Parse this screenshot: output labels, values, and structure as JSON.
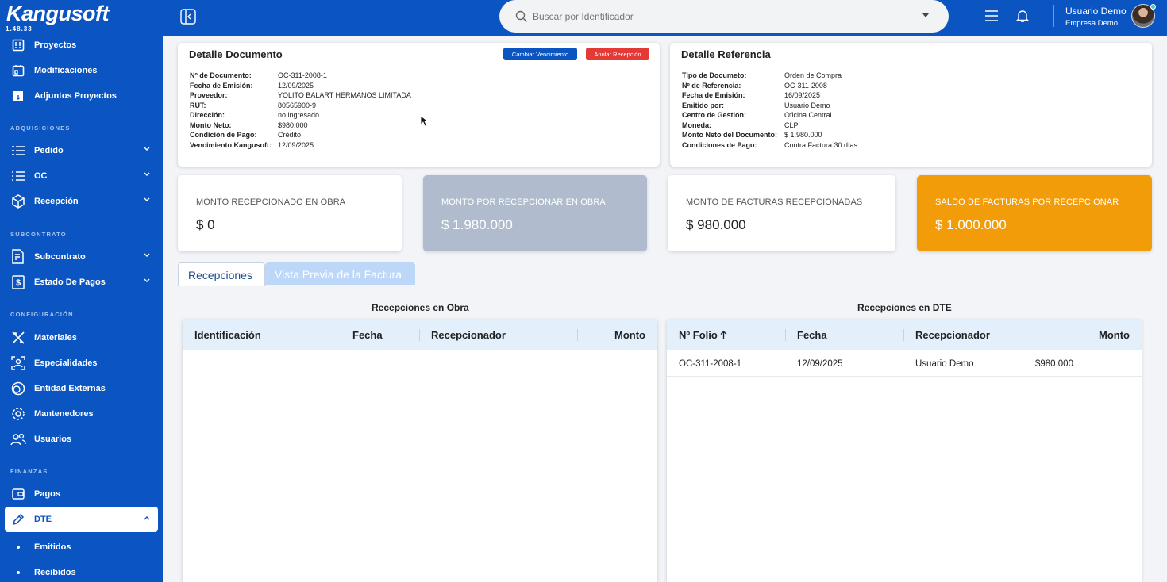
{
  "app": {
    "logo": "Kangusoft",
    "version": "1.48.33"
  },
  "sidebar": {
    "top_items": [
      {
        "label": "Proyectos",
        "icon": "projects-icon"
      },
      {
        "label": "Modificaciones",
        "icon": "modifications-icon"
      },
      {
        "label": "Adjuntos Proyectos",
        "icon": "attachments-icon"
      }
    ],
    "sections": {
      "adquisiciones": "ADQUISICIONES",
      "subcontrato": "SUBCONTRATO",
      "configuracion": "CONFIGURACIÓN",
      "finanzas": "FINANZAS"
    },
    "adq_items": [
      {
        "label": "Pedido",
        "icon": "list-icon"
      },
      {
        "label": "OC",
        "icon": "checklist-icon"
      },
      {
        "label": "Recepción",
        "icon": "box-icon"
      }
    ],
    "sub_items": [
      {
        "label": "Subcontrato",
        "icon": "document-edit-icon"
      },
      {
        "label": "Estado De Pagos",
        "icon": "dollar-icon"
      }
    ],
    "config_items": [
      {
        "label": "Materiales",
        "icon": "tools-icon"
      },
      {
        "label": "Especialidades",
        "icon": "person-scan-icon"
      },
      {
        "label": "Entidad Externas",
        "icon": "circles-icon"
      },
      {
        "label": "Mantenedores",
        "icon": "gear-icon"
      },
      {
        "label": "Usuarios",
        "icon": "users-icon"
      }
    ],
    "fin_items": [
      {
        "label": "Pagos",
        "icon": "wallet-icon"
      },
      {
        "label": "DTE",
        "icon": "pencil-icon"
      }
    ],
    "dte_sub": [
      "Emitidos",
      "Recibidos"
    ]
  },
  "header": {
    "search_placeholder": "Buscar por Identificador",
    "user_name": "Usuario Demo",
    "company": "Empresa Demo"
  },
  "detalle_documento": {
    "title": "Detalle Documento",
    "btn_cambiar": "Cambiar Vencimiento",
    "btn_anular": "Anular Recepción",
    "fields": [
      {
        "k": "Nº de Documento:",
        "v": "OC-311-2008-1"
      },
      {
        "k": "Fecha de Emisión:",
        "v": "12/09/2025"
      },
      {
        "k": "Proveedor:",
        "v": "YOLITO BALART HERMANOS LIMITADA"
      },
      {
        "k": "RUT:",
        "v": "80565900-9"
      },
      {
        "k": "Dirección:",
        "v": "no ingresado"
      },
      {
        "k": "Monto Neto:",
        "v": "$980.000"
      },
      {
        "k": "Condición de Pago:",
        "v": "Crédito"
      },
      {
        "k": "Vencimiento Kangusoft:",
        "v": "12/09/2025"
      }
    ]
  },
  "detalle_referencia": {
    "title": "Detalle Referencia",
    "fields": [
      {
        "k": "Tipo de Documeto:",
        "v": "Orden de Compra"
      },
      {
        "k": "Nº de Referencia:",
        "v": "OC-311-2008"
      },
      {
        "k": "Fecha de Emisión:",
        "v": "16/09/2025"
      },
      {
        "k": "Emitido por:",
        "v": "Usuario Demo"
      },
      {
        "k": "Centro de Gestión:",
        "v": "Oficina Central"
      },
      {
        "k": "Moneda:",
        "v": "CLP"
      },
      {
        "k": "Monto Neto del Documento:",
        "v": "$ 1.980.000"
      },
      {
        "k": "Condiciones de Pago:",
        "v": "Contra Factura 30 días"
      }
    ]
  },
  "stats": [
    {
      "label": "MONTO RECEPCIONADO EN OBRA",
      "value": "$ 0",
      "bg": "#ffffff",
      "fg": "#555555",
      "vfg": "#222222"
    },
    {
      "label": "MONTO POR RECEPCIONAR EN OBRA",
      "value": "$ 1.980.000",
      "bg": "#b0bccd",
      "fg": "#ffffff",
      "vfg": "#ffffff"
    },
    {
      "label": "MONTO DE FACTURAS RECEPCIONADAS",
      "value": "$ 980.000",
      "bg": "#ffffff",
      "fg": "#555555",
      "vfg": "#222222"
    },
    {
      "label": "SALDO DE FACTURAS POR RECEPCIONAR",
      "value": "$ 1.000.000",
      "bg": "#f39c0a",
      "fg": "#ffffff",
      "vfg": "#ffffff"
    }
  ],
  "tabs": [
    {
      "label": "Recepciones",
      "active": true
    },
    {
      "label": "Vista Previa de la Factura",
      "active": false
    }
  ],
  "obra": {
    "title": "Recepciones en Obra",
    "columns": [
      "Identificación",
      "Fecha",
      "Recepcionador",
      "Monto"
    ]
  },
  "dte": {
    "title": "Recepciones en DTE",
    "columns": [
      "Nº Folio",
      "Fecha",
      "Recepcionador",
      "Monto"
    ],
    "rows": [
      {
        "folio": "OC-311-2008-1",
        "fecha": "12/09/2025",
        "recepcionador": "Usuario Demo",
        "monto": "$980.000"
      }
    ]
  },
  "colors": {
    "brand": "#0a55c2",
    "danger": "#e53935",
    "primary_btn": "#0a55c2",
    "orange": "#f39c0a"
  }
}
